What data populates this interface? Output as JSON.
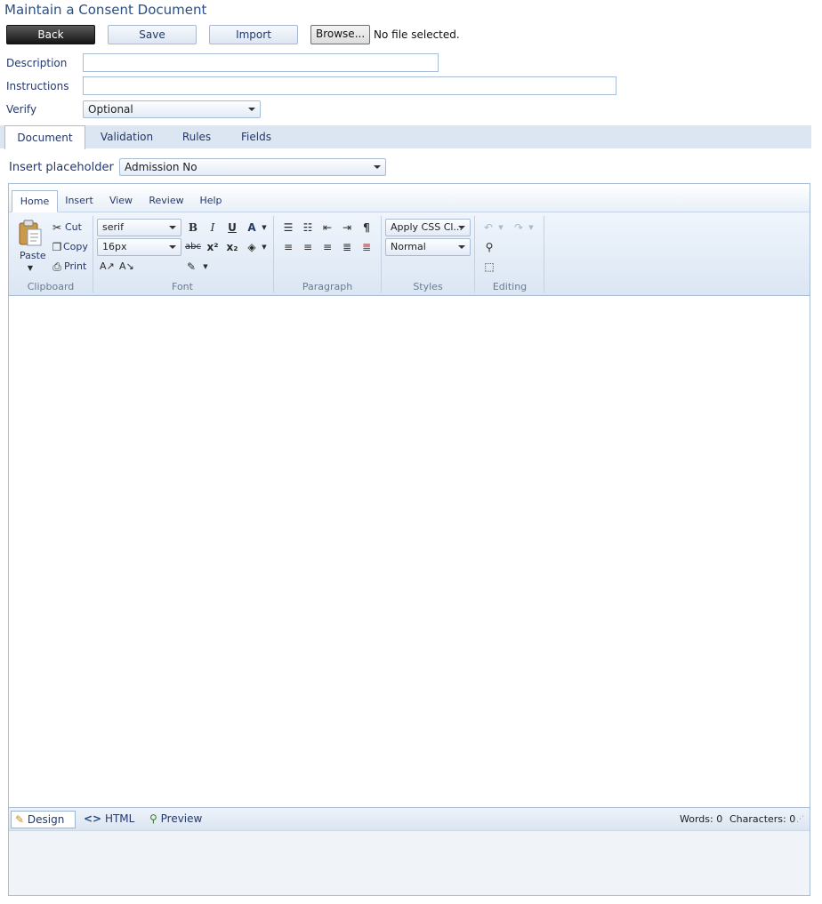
{
  "page": {
    "title": "Maintain a Consent Document"
  },
  "toolbar": {
    "back_label": "Back",
    "save_label": "Save",
    "import_label": "Import",
    "browse_label": "Browse...",
    "file_status": "No file selected."
  },
  "form": {
    "description_label": "Description",
    "description_value": "",
    "instructions_label": "Instructions",
    "instructions_value": "",
    "verify_label": "Verify",
    "verify_value": "Optional"
  },
  "doc_tabs": [
    "Document",
    "Validation",
    "Rules",
    "Fields"
  ],
  "placeholder": {
    "label": "Insert placeholder",
    "value": "Admission No"
  },
  "ribbon_tabs": [
    "Home",
    "Insert",
    "View",
    "Review",
    "Help"
  ],
  "ribbon": {
    "clipboard": {
      "group": "Clipboard",
      "paste": "Paste",
      "cut": "Cut",
      "copy": "Copy",
      "print": "Print"
    },
    "font": {
      "group": "Font",
      "family": "serif",
      "size": "16px"
    },
    "paragraph": {
      "group": "Paragraph"
    },
    "styles": {
      "group": "Styles",
      "css_class": "Apply CSS Cl...",
      "format": "Normal"
    },
    "editing": {
      "group": "Editing"
    }
  },
  "modes": [
    "Design",
    "HTML",
    "Preview"
  ],
  "status": {
    "words": "Words: 0",
    "characters": "Characters: 0"
  },
  "colors": {
    "title": "#2a4f83",
    "accent": "#a9bcd6",
    "tabbar": "#dce6f2"
  }
}
